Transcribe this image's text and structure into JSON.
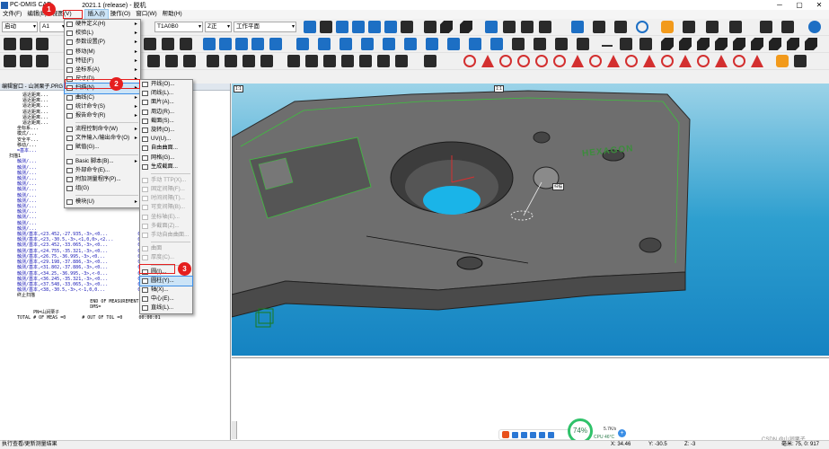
{
  "title": "PC-DMIS CAD ++ 2021.1 (release) - 脱机",
  "title_left": "PC-DMIS CAD",
  "title_right": "2021.1 (release) - 脱机",
  "window_controls": [
    "─",
    "▢",
    "✕"
  ],
  "menubar": [
    "文件(F)",
    "编辑(E)",
    "视图(V)",
    "插入(I)",
    "操作(O)",
    "窗口(W)",
    "帮助(H)"
  ],
  "toolbar": {
    "mode_combo": "启动",
    "probe_combo": "A1",
    "tip_combo": "T1A0B0",
    "axis_combo": "Z正",
    "workplane_combo": "工作平面"
  },
  "edit_window": {
    "title": "编辑窗口 - 山涧栗子.PRG",
    "lines": [
      "     逼近距离...",
      "     逼近距离...",
      "     逼近距离...",
      "     逼近距离...",
      "     逼近距离...",
      "     逼近距离...",
      "   坐标系...",
      "   模式/...",
      "   安全平...",
      "   移动/...",
      "   =基本...",
      "扫描1",
      "   触测/...                                      1,0>,<37",
      "   触测/...                                      0,0>,<37",
      "   触测/...                                      0,0>,<37",
      "   触测/...                                      0,0>,<37",
      "   触测/...                                      0,0>,<37",
      "   触测/...                                      1,0>,<37",
      "   触测/...                                      1,0>,<37",
      "   触测/...                                      0,0>,<37",
      "   触测/...                                      0,0>,<37",
      "   触测/...                                      0,0>,<37",
      "   触测/...                                      6,75,<24",
      "   触测/...                                      1,0>,<24",
      "   触测/...                                      0,0>,<24",
      "   触测/基本,<23.452,-27.935,-3>,<0...           0,0>,<23.4",
      "   触测/基本,<23,-30.5,-3>,<1,0,0>,<2...         0,0>,<24",
      "   触测/基本,<23.452,-33.065,-3>,<0...           0,0>,<23.4",
      "   触测/基本,<24.755,-35.321,-3>,<0...           0,0>,<24.7",
      "   触测/基本,<26.75,-36.995,-3>,<0...            0,0>,<26.7",
      "   触测/基本,<29.198,-37.886,-3>,<0...           0,0>,<29.1",
      "   触测/基本,<31.802,-37.886,-3>,<0...           0,0>,<31.8",
      "   触测/基本,<34.25,-36.995,-3>,<-0...           0,0>,<34.2",
      "   触测/基本,<36.245,-35.321,-3>,<0...           0,0>,<36.2",
      "   触测/基本,<37.548,-33.065,-3>,<0...           0,0>,<37.5",
      "   触测/基本,<38,-30.5,-3>,<-1,0,0...            0,0>,<38",
      "   终止扫描",
      "",
      "                              END OF MEASUREMENT FOR",
      "                              DMS=",
      "         PN=山涧栗子",
      "   TOTAL # OF MEAS =0      # OUT OF TOL =0      00:00:01"
    ]
  },
  "insert_menu": [
    {
      "label": "硬件定义(H)",
      "submenu": true
    },
    {
      "label": "校验(L)",
      "submenu": true
    },
    {
      "label": "参数设置(P)",
      "submenu": true
    },
    {
      "label": "移动(M)",
      "submenu": true
    },
    {
      "label": "特征(F)",
      "submenu": true
    },
    {
      "label": "坐标系(A)",
      "submenu": true
    },
    {
      "label": "尺寸(D)",
      "submenu": true
    },
    {
      "label": "扫描(N)",
      "submenu": true,
      "selected": true
    },
    {
      "label": "曲线(C)",
      "submenu": true
    },
    {
      "label": "统计命令(S)",
      "submenu": true
    },
    {
      "label": "报告命令(R)",
      "submenu": true
    },
    {
      "sep": true
    },
    {
      "label": "流程控制命令(W)",
      "submenu": true
    },
    {
      "label": "文件输入/输出命令(O)",
      "submenu": true
    },
    {
      "label": "賦值(G)..."
    },
    {
      "sep": true
    },
    {
      "label": "Basic 脚本(B)...",
      "submenu": true
    },
    {
      "label": "外部命令(E)..."
    },
    {
      "label": "附加测量程序(P)..."
    },
    {
      "label": "组(G)"
    },
    {
      "sep": true
    },
    {
      "label": "模块(U)",
      "submenu": true
    }
  ],
  "scan_submenu": [
    {
      "label": "开线(O)..."
    },
    {
      "label": "闭线(L)..."
    },
    {
      "label": "面片(A)..."
    },
    {
      "label": "周边(R)..."
    },
    {
      "label": "截面(S)..."
    },
    {
      "label": "旋转(O)..."
    },
    {
      "label": "UV(U)..."
    },
    {
      "label": "自由曲面..."
    },
    {
      "label": "网格(G)..."
    },
    {
      "label": "生成截面..."
    },
    {
      "sep": true
    },
    {
      "label": "手动 TTP(X)...",
      "disabled": true
    },
    {
      "label": "固定间隔(F)...",
      "disabled": true
    },
    {
      "label": "时间间隔(T)...",
      "disabled": true
    },
    {
      "label": "可变间隔(B)...",
      "disabled": true
    },
    {
      "label": "坐标轴(E)...",
      "disabled": true
    },
    {
      "label": "多截面(Z)...",
      "disabled": true
    },
    {
      "label": "手动自由曲面...",
      "disabled": true
    },
    {
      "sep": true
    },
    {
      "label": "曲面",
      "disabled": true
    },
    {
      "label": "厚度(C)...",
      "disabled": true
    },
    {
      "sep": true
    },
    {
      "label": "圆(I)..."
    },
    {
      "label": "圆柱(Y)...",
      "selected": true
    },
    {
      "label": "轴(X)..."
    },
    {
      "label": "中心(E)..."
    },
    {
      "label": "直线(L)..."
    }
  ],
  "steps": [
    "1",
    "2",
    "3"
  ],
  "cad_labels": {
    "view_tag_left": "1:1",
    "view_tag_center": "1:1",
    "hexagon_text": "HEXAGON",
    "feature_label": "扫描"
  },
  "status": {
    "left": "执行查看/更新测量结果",
    "x": "X: 34.46",
    "y": "Y: -30.5",
    "z": "Z: -3",
    "right": "毫米: 75, 0: 917"
  },
  "taskbar": {
    "cpu_percent": "74%",
    "cpu_label": "CPU 46°C",
    "net_speed": "5.7K/s",
    "watermark": "CSDN @山涧栗子"
  },
  "colors": {
    "highlight": "#e51f1f",
    "menu_selection": "#cce4f7",
    "cad_background": "#2e9fcf",
    "part_gray": "#6b6b6b"
  }
}
